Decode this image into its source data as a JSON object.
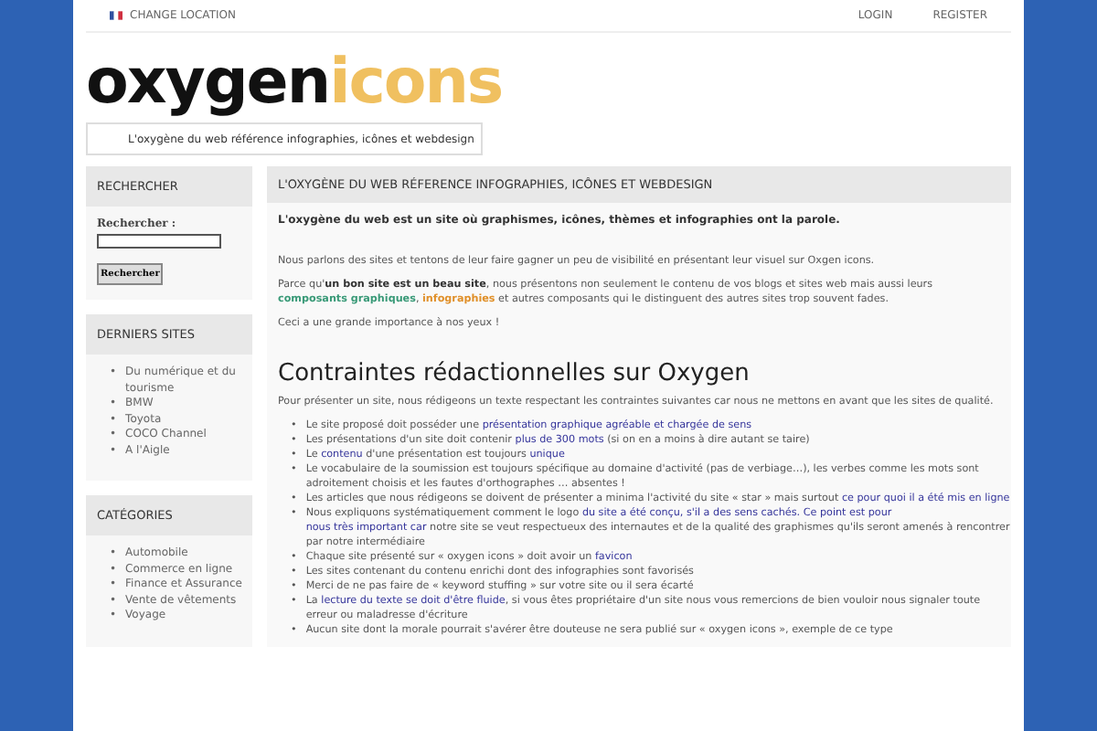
{
  "topbar": {
    "location": "CHANGE LOCATION",
    "links": [
      "LOGIN",
      "REGISTER"
    ]
  },
  "logo": {
    "dark": "oxygen",
    "light": "icons"
  },
  "breadcrumb": "L'oxygène du web référence infographies, icônes et webdesign",
  "sidebar": [
    {
      "kind": "search",
      "title": "RECHERCHER",
      "label": "Rechercher :",
      "button": "Rechercher"
    },
    {
      "kind": "list",
      "title": "DERNIERS SITES",
      "marker": "•",
      "items": [
        "Du numérique et du tourisme",
        "BMW",
        "Toyota",
        "COCO Channel",
        "A l'Aigle"
      ]
    },
    {
      "kind": "list",
      "title": "CATÉGORIES",
      "marker": "•",
      "items": [
        "Automobile",
        "Commerce en ligne",
        "Finance et Assurance",
        "Vente de vêtements",
        "Voyage"
      ]
    }
  ],
  "main": {
    "title": "L'OXYGÈNE DU WEB RÉFERENCE INFOGRAPHIES, ICÔNES ET WEBDESIGN",
    "lead": "L'oxygène du web est un site où graphismes, icônes, thèmes et infographies ont la parole.",
    "paragraphs": [
      [
        {
          "kind": "text",
          "text": "Nous parlons des sites et tentons de leur faire gagner un peu de visibilité en présentant leur visuel sur Oxgen icons."
        }
      ],
      [
        {
          "kind": "text",
          "text": "Parce qu'"
        },
        {
          "kind": "bold",
          "text": "un bon site est un beau site"
        },
        {
          "kind": "text",
          "text": ", nous présentons non seulement le contenu de vos blogs et sites web mais aussi leurs "
        },
        {
          "kind": "green",
          "text": "composants graphiques"
        },
        {
          "kind": "text",
          "text": ", "
        },
        {
          "kind": "orange",
          "text": "infographies"
        },
        {
          "kind": "text",
          "text": " et autres composants qui le distinguent des autres sites trop souvent fades."
        }
      ],
      [
        {
          "kind": "text",
          "text": "Ceci a une grande importance à nos yeux !"
        }
      ]
    ],
    "heading": "Contraintes rédactionnelles sur Oxygen",
    "intro": "Pour présenter un site, nous rédigeons un texte respectant les contraintes suivantes car nous ne mettons en avant que les sites de qualité.",
    "marker": "•",
    "rules": [
      [
        {
          "kind": "text",
          "text": "Le site proposé doit posséder une "
        },
        {
          "kind": "link",
          "text": "présentation graphique agréable et chargée de sens"
        }
      ],
      [
        {
          "kind": "text",
          "text": "Les présentations d'un site doit contenir "
        },
        {
          "kind": "link",
          "text": "plus de 300 mots"
        },
        {
          "kind": "text",
          "text": " (si on en a moins à dire autant se taire)"
        }
      ],
      [
        {
          "kind": "text",
          "text": "Le "
        },
        {
          "kind": "link",
          "text": "contenu"
        },
        {
          "kind": "text",
          "text": " d'une présentation est toujours "
        },
        {
          "kind": "link",
          "text": "unique"
        }
      ],
      [
        {
          "kind": "text",
          "text": "Le vocabulaire de la soumission est toujours spécifique au domaine d'activité (pas de verbiage…), les verbes comme les mots sont adroitement choisis et les fautes d'orthographes … absentes !"
        }
      ],
      [
        {
          "kind": "text",
          "text": "Les articles que nous rédigeons se doivent de présenter a minima l'activité du site « star » mais surtout "
        },
        {
          "kind": "link",
          "text": "ce pour quoi il a été mis en ligne"
        }
      ],
      [
        {
          "kind": "text",
          "text": "Nous expliquons systématiquement comment le logo "
        },
        {
          "kind": "link",
          "text": "du site a été conçu, s'il a des sens cachés."
        },
        {
          "kind": "link",
          "text": "Ce point est pour"
        },
        {
          "kind": "link",
          "text": "nous très important car"
        },
        {
          "kind": "text",
          "text": " notre site se veut respectueux des internautes et de la qualité des graphismes qu'ils seront amenés à rencontrer par notre intermédiaire"
        }
      ],
      [
        {
          "kind": "text",
          "text": "Chaque site présenté sur « oxygen icons » doit avoir un "
        },
        {
          "kind": "link",
          "text": "favicon"
        }
      ],
      [
        {
          "kind": "text",
          "text": "Les sites contenant du contenu enrichi dont des infographies sont favorisés"
        }
      ],
      [
        {
          "kind": "text",
          "text": "Merci de ne pas faire de « keyword stuffing » sur votre site ou il sera écarté"
        }
      ],
      [
        {
          "kind": "text",
          "text": "La "
        },
        {
          "kind": "link",
          "text": "lecture du texte se doit d'être fluide"
        },
        {
          "kind": "text",
          "text": ", si vous êtes propriétaire d'un site nous vous remercions de bien vouloir nous signaler toute erreur ou maladresse d'écriture"
        }
      ],
      [
        {
          "kind": "text",
          "text": "Aucun site dont la morale pourrait s'avérer être douteuse ne sera publié sur « oxygen icons »,  exemple de ce type"
        }
      ]
    ]
  }
}
